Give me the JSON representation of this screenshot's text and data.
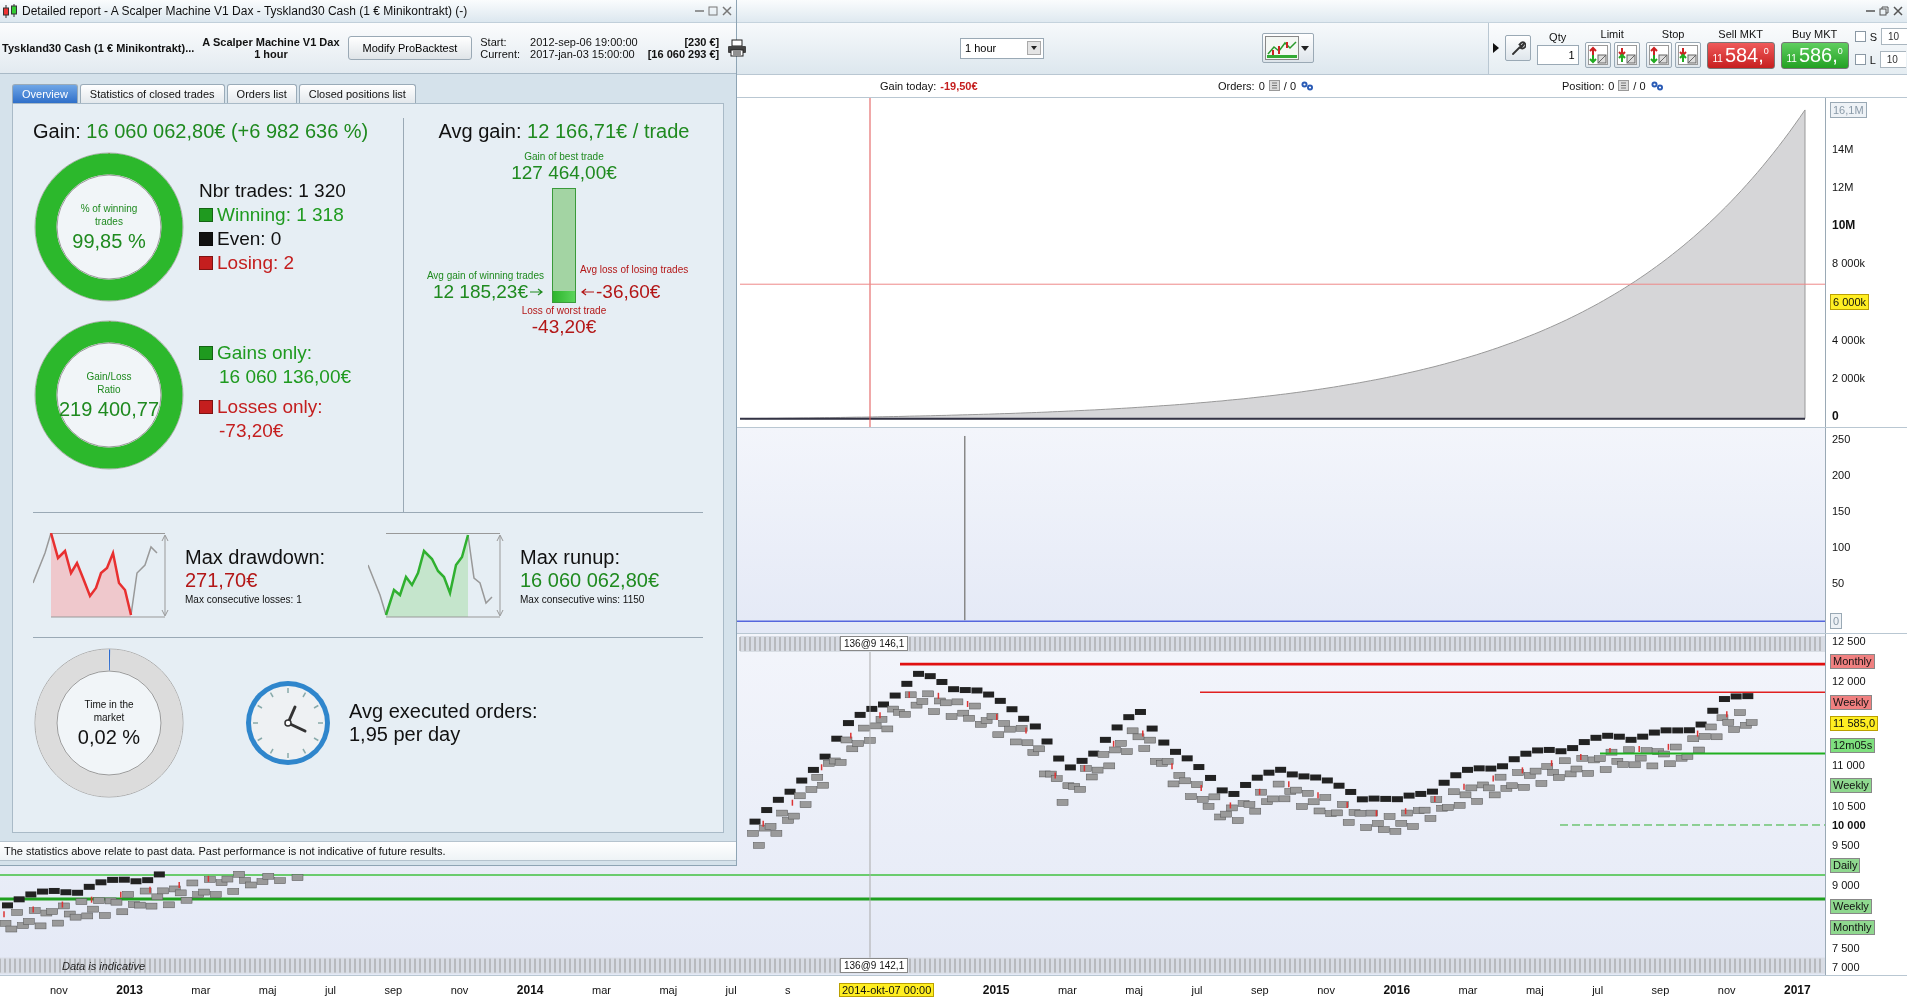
{
  "report_window": {
    "title": "Detailed report - A Scalper Machine V1 Dax - Tyskland30 Cash (1 € Minikontrakt) (-)",
    "instrument": "Tyskland30 Cash (1 € Minikontrakt)...",
    "system": "A Scalper Machine V1 Dax",
    "timeframe": "1 hour",
    "modify_button": "Modify ProBacktest",
    "period": [
      {
        "label": "Start:",
        "date": "2012-sep-06 19:00:00",
        "capital": "[230 €]"
      },
      {
        "label": "Current:",
        "date": "2017-jan-03 15:00:00",
        "capital": "[16 060 293 €]"
      }
    ],
    "tabs": [
      {
        "label": "Overview",
        "selected": true
      },
      {
        "label": "Statistics of closed trades",
        "selected": false
      },
      {
        "label": "Orders list",
        "selected": false
      },
      {
        "label": "Closed positions list",
        "selected": false
      }
    ],
    "gain": {
      "label": "Gain:",
      "value": "16 060 062,80€ (+6 982 636 %)"
    },
    "donuts": [
      {
        "kind": "ratio",
        "label": "% of winning trades",
        "value": "99,85 %",
        "level": 0.9985
      },
      {
        "kind": "ratio",
        "label": "Gain/Loss Ratio",
        "value": "219 400,77",
        "level": 0.99999
      }
    ],
    "trades": {
      "total": "Nbr trades: 1 320",
      "legend": [
        {
          "label": "Winning: 1 318",
          "color": "#1f9a1f"
        },
        {
          "label": "Even: 0",
          "color": "#111111"
        },
        {
          "label": "Losing: 2",
          "color": "#c41e1e"
        }
      ]
    },
    "totals": [
      {
        "label": "Gains only:",
        "value": "16 060 136,00€",
        "color": "#1f9a1f"
      },
      {
        "label": "Losses only:",
        "value": "-73,20€",
        "color": "#c41e1e"
      }
    ],
    "avg_gain": {
      "label": "Avg gain:",
      "value": "12 166,71€ / trade"
    },
    "best_trade": {
      "label": "Gain of best trade",
      "value": "127 464,00€"
    },
    "avg_winning": {
      "label": "Avg gain of winning trades",
      "value": "12 185,23€",
      "level": 0.096
    },
    "avg_losing": {
      "label": "Avg loss of losing trades",
      "value": "-36,60€"
    },
    "worst_trade": {
      "label": "Loss of worst trade",
      "value": "-43,20€"
    },
    "extremes": [
      {
        "kind": "drawdown",
        "label": "Max drawdown:",
        "value": "271,70€",
        "note": "Max consecutive losses: 1"
      },
      {
        "kind": "runup",
        "label": "Max runup:",
        "value": "16 060 062,80€",
        "note": "Max consecutive wins: 1150"
      }
    ],
    "time_in_market": {
      "kind": "time",
      "label": "Time in the market",
      "value": "0,02 %",
      "level": 0.0002
    },
    "orders": {
      "label": "Avg executed orders:",
      "value": "1,95 per day"
    },
    "footer": "The statistics above relate to past data. Past performance is not indicative of future results."
  },
  "chart_window": {
    "timeframe": "1 hour",
    "toolbar": {
      "qty": {
        "label": "Qty",
        "value": "1"
      },
      "limit": "Limit",
      "stop": "Stop",
      "quotes": [
        {
          "kind": "sell",
          "label": "Sell MKT",
          "prefix": "11",
          "price": "584,$^{0}$"
        },
        {
          "kind": "buy",
          "label": "Buy MKT",
          "prefix": "11",
          "price": "586,$^{0}$"
        }
      ],
      "options": [
        {
          "label": "S",
          "checked": false,
          "value": "10"
        },
        {
          "label": "L",
          "checked": false,
          "value": "10"
        }
      ]
    },
    "status": {
      "gain_today": {
        "label": "Gain today:",
        "value": "-19,50€"
      },
      "orders": {
        "label": "Orders:",
        "count": "0",
        "pending": "/ 0"
      },
      "position": {
        "label": "Position:",
        "count": "0",
        "pending": "/ 0"
      }
    },
    "equity_axis": [
      {
        "kind": "limit",
        "text": "16,1M"
      },
      {
        "kind": "tick",
        "text": "14M"
      },
      {
        "kind": "tick",
        "text": "12M"
      },
      {
        "kind": "tick",
        "text": "10M",
        "major": true
      },
      {
        "kind": "tick",
        "text": "8 000k"
      },
      {
        "kind": "current",
        "text": "6 000k"
      },
      {
        "kind": "tick",
        "text": "4 000k"
      },
      {
        "kind": "tick",
        "text": "2 000k"
      },
      {
        "kind": "tick",
        "text": "0",
        "major": true
      }
    ],
    "histogram_axis": [
      {
        "kind": "tick",
        "text": "250"
      },
      {
        "kind": "tick",
        "text": "200"
      },
      {
        "kind": "tick",
        "text": "150"
      },
      {
        "kind": "tick",
        "text": "100"
      },
      {
        "kind": "tick",
        "text": "50"
      },
      {
        "kind": "limit",
        "text": "0"
      }
    ],
    "price_axis": [
      {
        "kind": "tick",
        "text": "12 500"
      },
      {
        "kind": "tag",
        "text": "Monthly",
        "color": "#f08080"
      },
      {
        "kind": "tick",
        "text": "12 000"
      },
      {
        "kind": "tag",
        "text": "Weekly",
        "color": "#f08080"
      },
      {
        "kind": "current",
        "text": "11 585,0"
      },
      {
        "kind": "tag",
        "text": "12m05s",
        "color": "#7ee07e"
      },
      {
        "kind": "tick",
        "text": "11 000"
      },
      {
        "kind": "tag",
        "text": "Weekly",
        "color": "#8fd88f"
      },
      {
        "kind": "tick",
        "text": "10 500"
      },
      {
        "kind": "tick",
        "text": "10 000",
        "major": true
      },
      {
        "kind": "tick",
        "text": "9 500"
      },
      {
        "kind": "tag",
        "text": "Daily",
        "color": "#8fd88f"
      },
      {
        "kind": "tick",
        "text": "9 000"
      },
      {
        "kind": "tag",
        "text": "Weekly",
        "color": "#8fd88f"
      },
      {
        "kind": "tag",
        "text": "Monthly",
        "color": "#8fd88f"
      },
      {
        "kind": "tick",
        "text": "7 500"
      },
      {
        "kind": "tick",
        "text": "7 000"
      }
    ],
    "cursor_labels": [
      "136@9 146,1",
      "136@9 142,1"
    ],
    "notice": "Data is indicative",
    "time_axis": [
      {
        "kind": "tick",
        "text": "nov"
      },
      {
        "kind": "tick",
        "text": "2013",
        "major": true
      },
      {
        "kind": "tick",
        "text": "mar"
      },
      {
        "kind": "tick",
        "text": "maj"
      },
      {
        "kind": "tick",
        "text": "jul"
      },
      {
        "kind": "tick",
        "text": "sep"
      },
      {
        "kind": "tick",
        "text": "nov"
      },
      {
        "kind": "tick",
        "text": "2014",
        "major": true
      },
      {
        "kind": "tick",
        "text": "mar"
      },
      {
        "kind": "tick",
        "text": "maj"
      },
      {
        "kind": "tick",
        "text": "jul"
      },
      {
        "kind": "tick",
        "text": "s"
      },
      {
        "kind": "cursor",
        "text": "2014-okt-07 00:00"
      },
      {
        "kind": "tick",
        "text": "2015",
        "major": true
      },
      {
        "kind": "tick",
        "text": "mar"
      },
      {
        "kind": "tick",
        "text": "maj"
      },
      {
        "kind": "tick",
        "text": "jul"
      },
      {
        "kind": "tick",
        "text": "sep"
      },
      {
        "kind": "tick",
        "text": "nov"
      },
      {
        "kind": "tick",
        "text": "2016",
        "major": true
      },
      {
        "kind": "tick",
        "text": "mar"
      },
      {
        "kind": "tick",
        "text": "maj"
      },
      {
        "kind": "tick",
        "text": "jul"
      },
      {
        "kind": "tick",
        "text": "sep"
      },
      {
        "kind": "tick",
        "text": "nov"
      },
      {
        "kind": "tick",
        "text": "2017",
        "major": true
      }
    ]
  }
}
